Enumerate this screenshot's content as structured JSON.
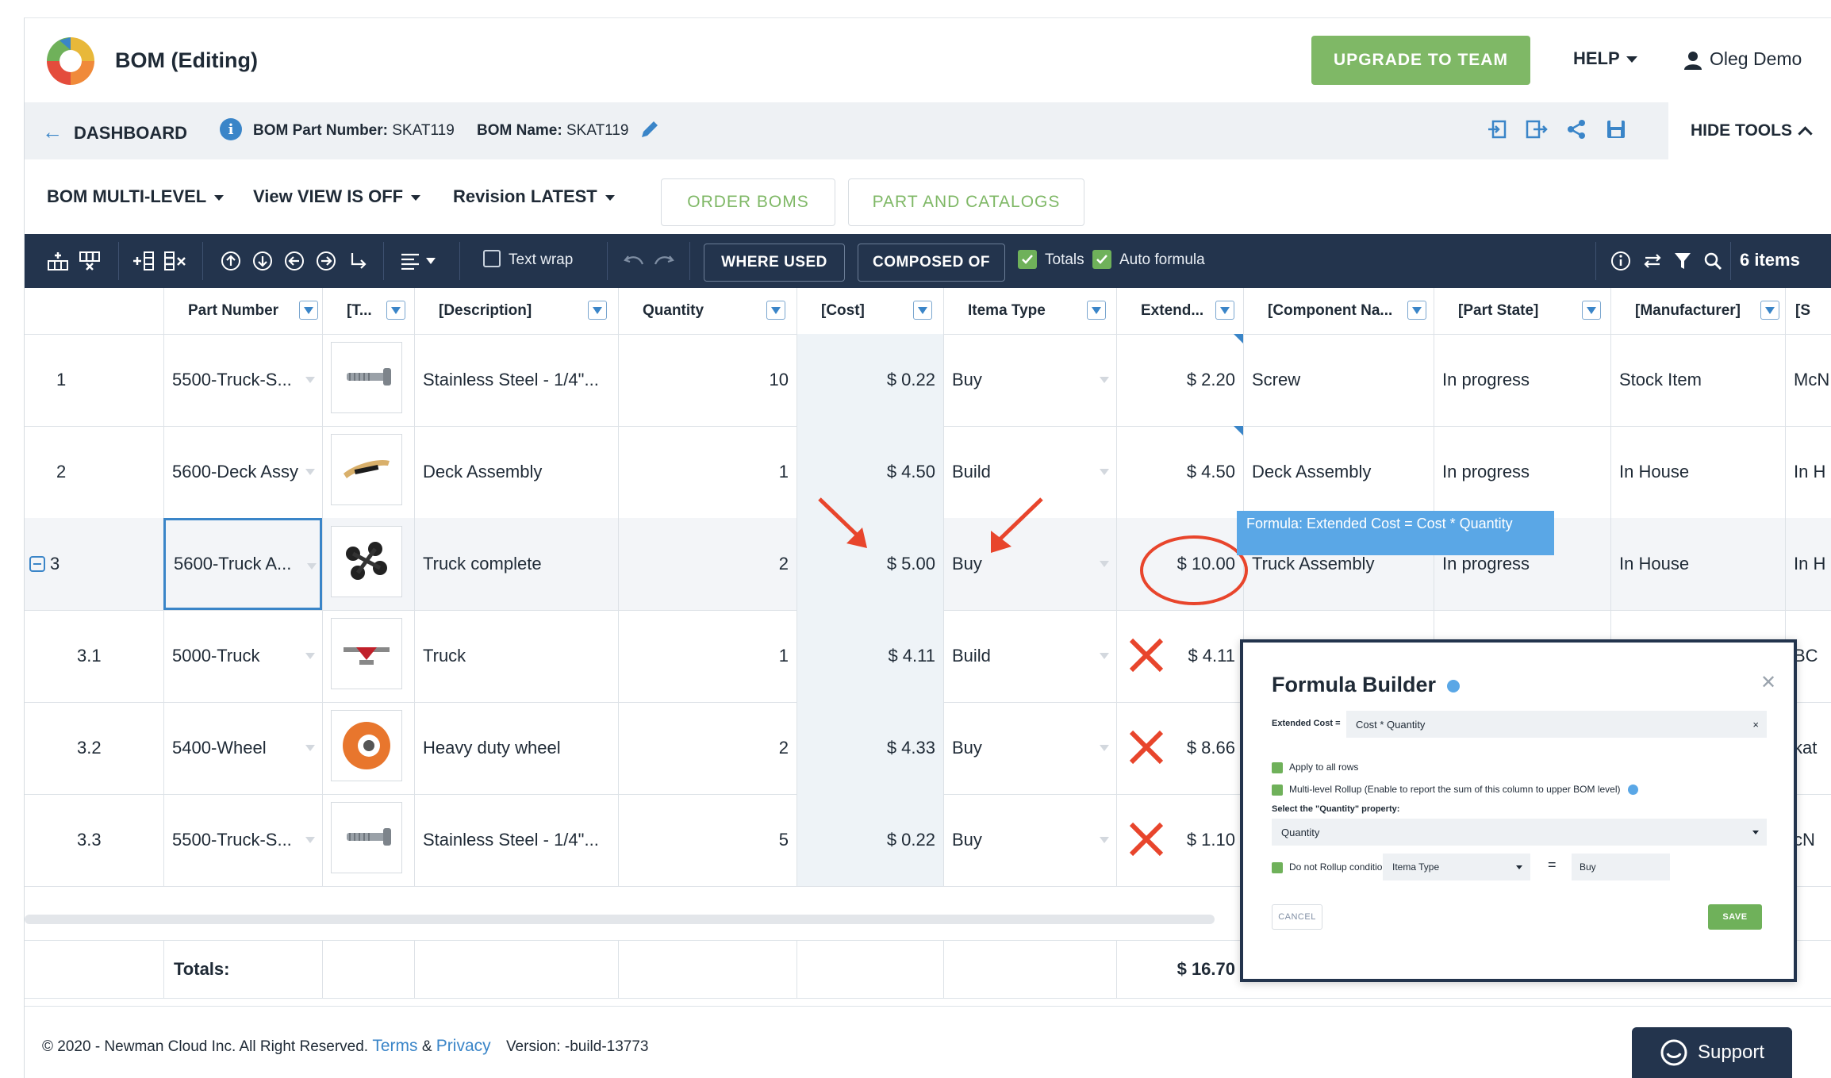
{
  "header": {
    "title": "BOM (Editing)",
    "upgrade": "UPGRADE TO TEAM",
    "help": "HELP",
    "user": "Oleg Demo"
  },
  "nav": {
    "back": "DASHBOARD",
    "part_number_label": "BOM Part Number:",
    "part_number": "SKAT119",
    "name_label": "BOM Name:",
    "name": "SKAT119",
    "hide_tools": "HIDE TOOLS"
  },
  "bar": {
    "bom_label": "BOM",
    "bom_value": "MULTI-LEVEL",
    "view_label": "View",
    "view_value": "VIEW IS OFF",
    "rev_label": "Revision",
    "rev_value": "LATEST",
    "order_boms": "ORDER BOMS",
    "part_catalogs": "PART AND CATALOGS"
  },
  "toolbar": {
    "text_wrap": "Text wrap",
    "where_used": "WHERE USED",
    "composed_of": "COMPOSED OF",
    "totals": "Totals",
    "auto_formula": "Auto formula",
    "items": "6 items"
  },
  "columns": [
    "Part Number",
    "[T...",
    "[Description]",
    "Quantity",
    "[Cost]",
    "Itema Type",
    "Extend...",
    "[Component Na...",
    "[Part State]",
    "[Manufacturer]",
    "[S"
  ],
  "rows": [
    {
      "num": "1",
      "part": "5500-Truck-S...",
      "desc": "Stainless Steel - 1/4\"...",
      "qty": "10",
      "cost": "$ 0.22",
      "type": "Buy",
      "ext": "$ 2.20",
      "comp": "Screw",
      "state": "In progress",
      "mfr": "Stock Item",
      "s": "McN",
      "thumb": "screw"
    },
    {
      "num": "2",
      "part": "5600-Deck Assy",
      "desc": "Deck Assembly",
      "qty": "1",
      "cost": "$ 4.50",
      "type": "Build",
      "ext": "$ 4.50",
      "comp": "Deck Assembly",
      "state": "In progress",
      "mfr": "In House",
      "s": "In H",
      "thumb": "deck"
    },
    {
      "num": "3",
      "part": "5600-Truck A...",
      "desc": "Truck complete",
      "qty": "2",
      "cost": "$ 5.00",
      "type": "Buy",
      "ext": "$ 10.00",
      "comp": "Truck Assembly",
      "state": "In progress",
      "mfr": "In House",
      "s": "In H",
      "thumb": "truckcomplete"
    },
    {
      "num": "3.1",
      "part": "5000-Truck",
      "desc": "Truck",
      "qty": "1",
      "cost": "$ 4.11",
      "type": "Build",
      "ext": "$ 4.11",
      "comp": "",
      "state": "",
      "mfr": "",
      "s": "BC",
      "thumb": "truck"
    },
    {
      "num": "3.2",
      "part": "5400-Wheel",
      "desc": "Heavy duty wheel",
      "qty": "2",
      "cost": "$ 4.33",
      "type": "Buy",
      "ext": "$ 8.66",
      "comp": "",
      "state": "",
      "mfr": "",
      "s": "kat",
      "thumb": "wheel"
    },
    {
      "num": "3.3",
      "part": "5500-Truck-S...",
      "desc": "Stainless Steel - 1/4\"...",
      "qty": "5",
      "cost": "$ 0.22",
      "type": "Buy",
      "ext": "$ 1.10",
      "comp": "",
      "state": "",
      "mfr": "",
      "s": "cN",
      "thumb": "screw"
    }
  ],
  "totals": {
    "label": "Totals:",
    "value": "$ 16.70"
  },
  "tooltip": "Formula: Extended Cost = Cost * Quantity",
  "formula_builder": {
    "title": "Formula Builder",
    "lhs": "Extended Cost =",
    "expr": "Cost  *  Quantity",
    "apply_all": "Apply to all rows",
    "rollup": "Multi-level Rollup (Enable to report the sum of this column to upper BOM level)",
    "select_label": "Select the \"Quantity\" property:",
    "select_value": "Quantity",
    "no_rollup": "Do not Rollup condition",
    "cond_field": "Itema Type",
    "equals": "=",
    "cond_value": "Buy",
    "cancel": "CANCEL",
    "save": "SAVE"
  },
  "footer": {
    "copyright": "© 2020 - Newman Cloud Inc. All Right Reserved.",
    "terms": "Terms",
    "amp": "&",
    "privacy": "Privacy",
    "version": "Version: -build-13773",
    "support": "Support"
  }
}
